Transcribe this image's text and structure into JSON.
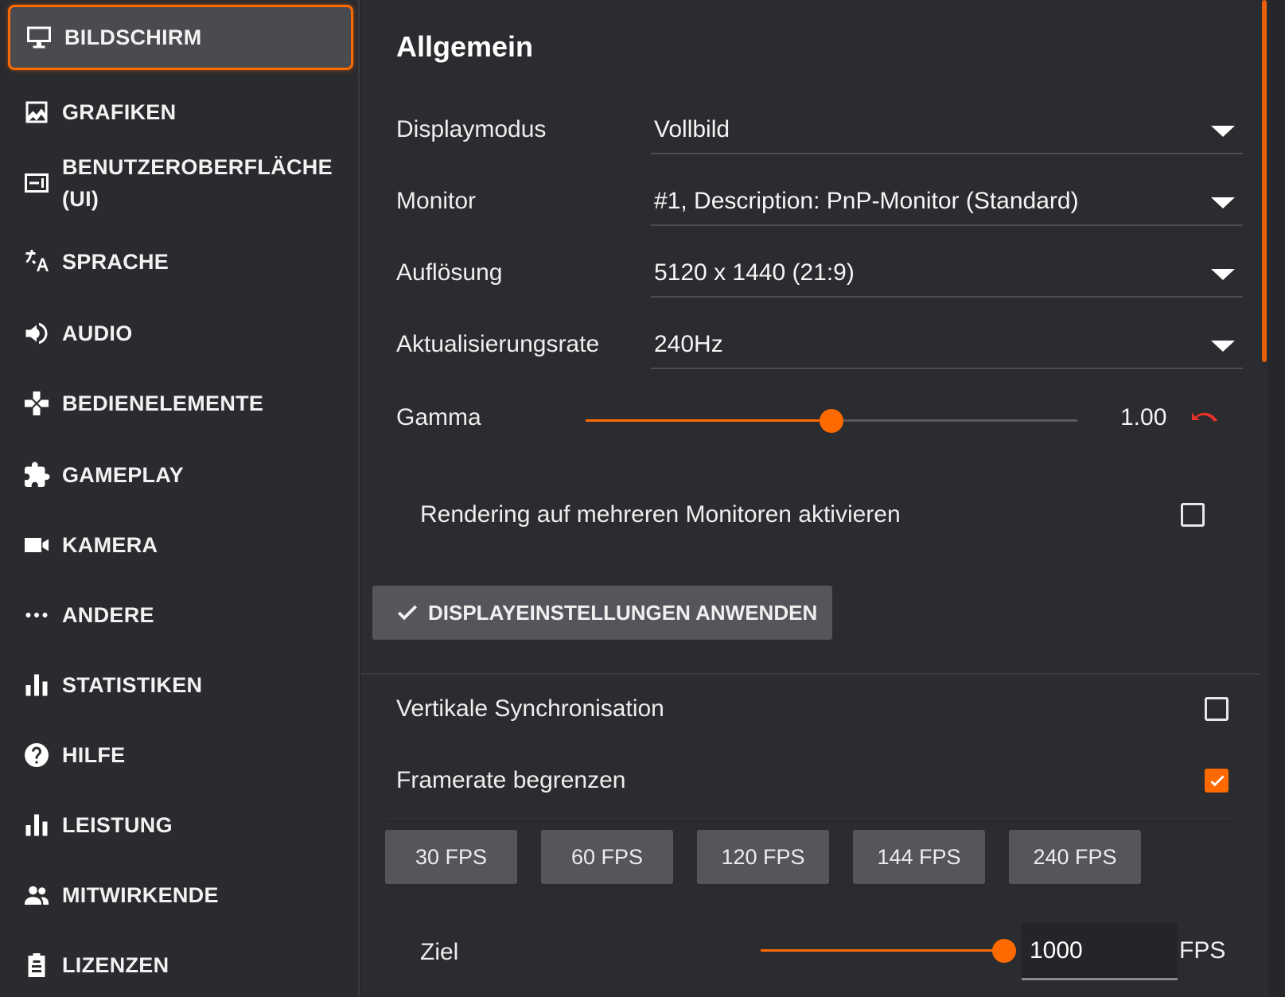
{
  "sidebar": {
    "items": [
      {
        "label": "BILDSCHIRM",
        "icon": "monitor-icon",
        "active": true
      },
      {
        "label": "GRAFIKEN",
        "icon": "image-icon"
      },
      {
        "label": "BENUTZEROBERFLÄCHE (UI)",
        "icon": "ui-layout-icon"
      },
      {
        "label": "SPRACHE",
        "icon": "translate-icon"
      },
      {
        "label": "AUDIO",
        "icon": "speaker-icon"
      },
      {
        "label": "BEDIENELEMENTE",
        "icon": "gamepad-icon"
      },
      {
        "label": "GAMEPLAY",
        "icon": "puzzle-icon"
      },
      {
        "label": "KAMERA",
        "icon": "camera-icon"
      },
      {
        "label": "ANDERE",
        "icon": "more-icon"
      },
      {
        "label": "STATISTIKEN",
        "icon": "bar-chart-icon"
      },
      {
        "label": "HILFE",
        "icon": "help-icon"
      },
      {
        "label": "LEISTUNG",
        "icon": "bar-chart-icon"
      },
      {
        "label": "MITWIRKENDE",
        "icon": "people-icon"
      },
      {
        "label": "LIZENZEN",
        "icon": "clipboard-icon"
      }
    ]
  },
  "main": {
    "section_title": "Allgemein",
    "display_mode": {
      "label": "Displaymodus",
      "value": "Vollbild"
    },
    "monitor": {
      "label": "Monitor",
      "value": "#1, Description: PnP-Monitor (Standard)"
    },
    "resolution": {
      "label": "Auflösung",
      "value": "5120 x 1440 (21:9)"
    },
    "refresh_rate": {
      "label": "Aktualisierungsrate",
      "value": "240Hz"
    },
    "gamma": {
      "label": "Gamma",
      "value": "1.00",
      "slider_fraction": 0.5
    },
    "multi_monitor": {
      "label": "Rendering auf mehreren Monitoren aktivieren",
      "checked": false
    },
    "apply_button": "DISPLAYEINSTELLUNGEN ANWENDEN",
    "vsync": {
      "label": "Vertikale Synchronisation",
      "checked": false
    },
    "framerate_limit": {
      "label": "Framerate begrenzen",
      "checked": true
    },
    "fps_presets": [
      "30 FPS",
      "60 FPS",
      "120 FPS",
      "144 FPS",
      "240 FPS"
    ],
    "target": {
      "label": "Ziel",
      "value": "1000",
      "unit": "FPS",
      "slider_fraction": 1.0
    }
  },
  "colors": {
    "accent": "#ff6a00",
    "background": "#2b2c2f",
    "reset_icon": "#e8332a"
  }
}
